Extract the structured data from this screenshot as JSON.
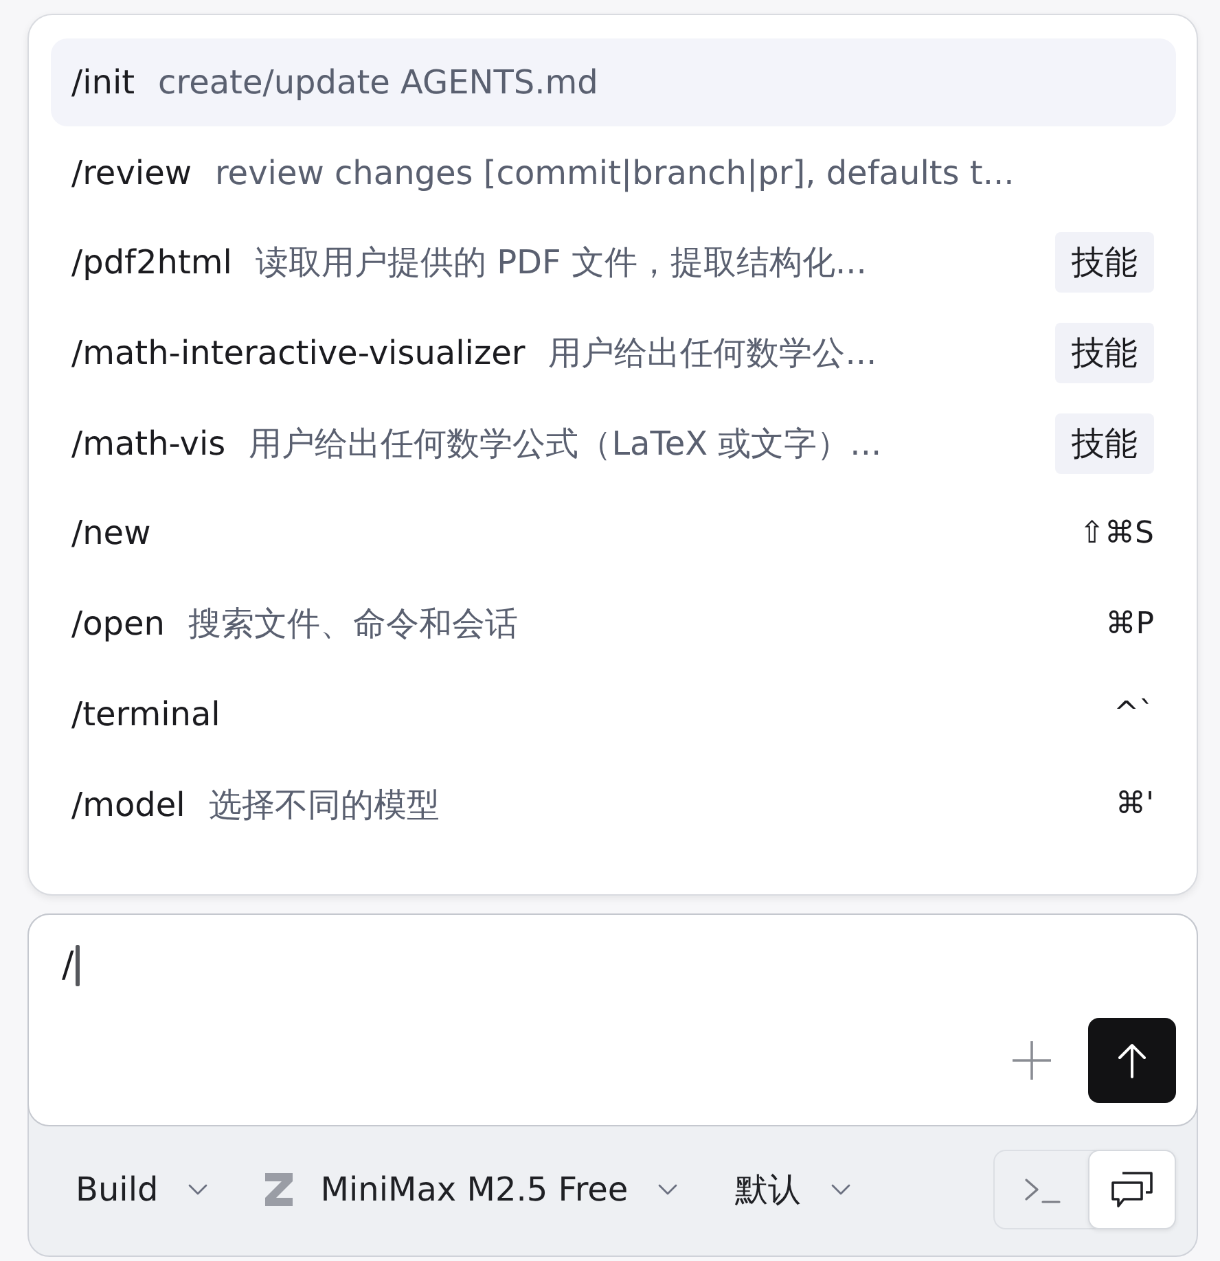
{
  "command_menu": {
    "items": [
      {
        "command": "/init",
        "description": "create/update AGENTS.md",
        "selected": true
      },
      {
        "command": "/review",
        "description": "review changes [commit|branch|pr], defaults t...",
        "selected": false
      },
      {
        "command": "/pdf2html",
        "description": "读取用户提供的 PDF 文件，提取结构化...",
        "badge": "技能",
        "selected": false
      },
      {
        "command": "/math-interactive-visualizer",
        "description": "用户给出任何数学公...",
        "badge": "技能",
        "selected": false
      },
      {
        "command": "/math-vis",
        "description": "用户给出任何数学公式（LaTeX 或文字）...",
        "badge": "技能",
        "selected": false
      },
      {
        "command": "/new",
        "shortcut": "⇧⌘S",
        "selected": false
      },
      {
        "command": "/open",
        "description": "搜索文件、命令和会话",
        "shortcut": "⌘P",
        "selected": false
      },
      {
        "command": "/terminal",
        "shortcut": "^`",
        "selected": false
      },
      {
        "command": "/model",
        "description": "选择不同的模型",
        "shortcut": "⌘'",
        "selected": false
      }
    ]
  },
  "composer": {
    "value": "/"
  },
  "toolbar": {
    "agent": "Build",
    "model": "MiniMax M2.5 Free",
    "variant": "默认",
    "view_modes": [
      {
        "kind": "terminal",
        "selected": false
      },
      {
        "kind": "chat",
        "selected": true
      }
    ]
  }
}
